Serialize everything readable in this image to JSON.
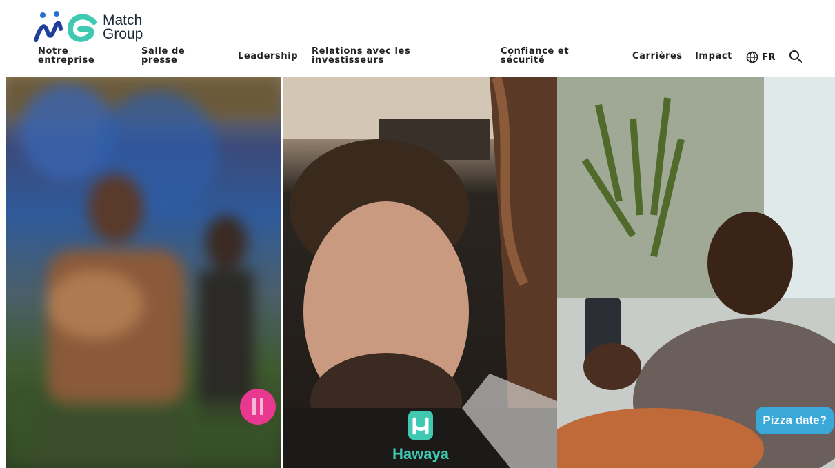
{
  "brand": {
    "name": "Match\nGroup"
  },
  "nav": {
    "items": [
      {
        "label": "Notre\nentreprise"
      },
      {
        "label": "Salle de\npresse"
      },
      {
        "label": "Leadership"
      },
      {
        "label": "Relations avec les\ninvestisseurs"
      },
      {
        "label": "Confiance et\nsécurité"
      },
      {
        "label": "Carrières"
      },
      {
        "label": "Impact"
      }
    ],
    "language": "FR"
  },
  "hero": {
    "panels": [
      {
        "description_icon": "pink-circle-icon"
      },
      {
        "app_label": "Hawaya"
      },
      {
        "chat_bubble": "Pizza date?"
      }
    ]
  },
  "colors": {
    "brand_blue": "#2a6fcf",
    "brand_teal": "#3fc9b3",
    "bubble": "#3aa8d8"
  }
}
